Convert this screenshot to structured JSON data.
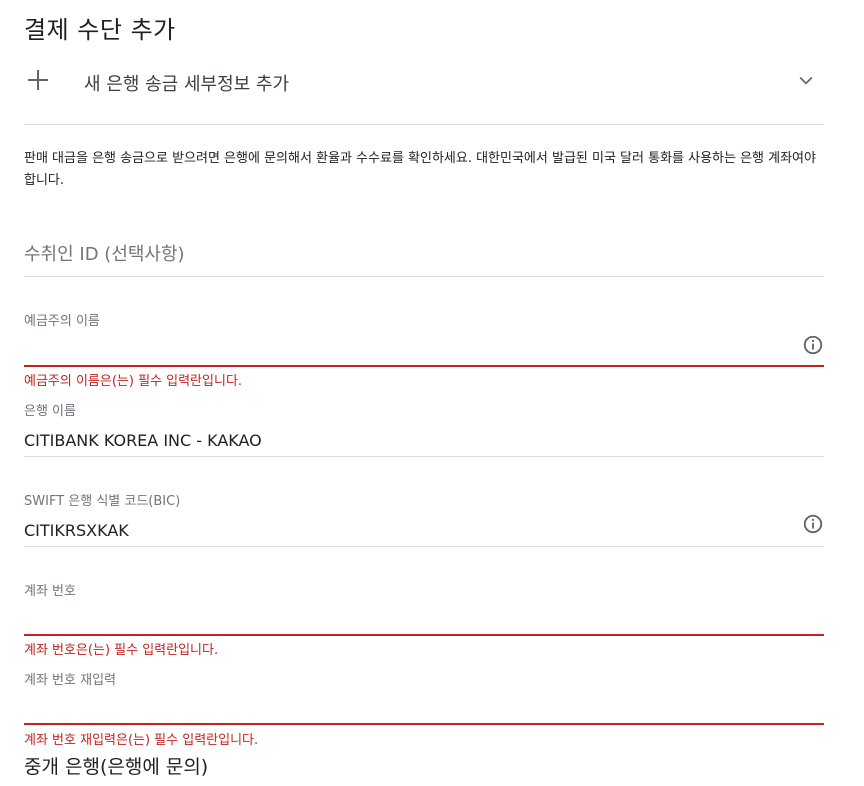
{
  "title": "결제 수단 추가",
  "expander": {
    "label": "새 은행 송금 세부정보 추가"
  },
  "description": "판매 대금을 은행 송금으로 받으려면 은행에 문의해서 환율과 수수료를 확인하세요. 대한민국에서 발급된 미국 달러 통화를 사용하는 은행 계좌여야 합니다.",
  "fields": {
    "payee_id": {
      "placeholder": "수취인 ID (선택사항)"
    },
    "account_holder": {
      "label": "예금주의 이름",
      "value": "",
      "error": "예금주의 이름은(는) 필수 입력란입니다."
    },
    "bank_name": {
      "label": "은행 이름",
      "value": "CITIBANK KOREA INC - KAKAO"
    },
    "swift": {
      "label": "SWIFT 은행 식별 코드(BIC)",
      "value": "CITIKRSXKAK"
    },
    "account_number": {
      "label": "계좌 번호",
      "value": "",
      "error": "계좌 번호은(는) 필수 입력란입니다."
    },
    "account_number_confirm": {
      "label": "계좌 번호 재입력",
      "value": "",
      "error": "계좌 번호 재입력은(는) 필수 입력란입니다."
    }
  },
  "intermediary_bank": {
    "label": "중개 은행(은행에 문의)"
  },
  "colors": {
    "error": "#c5221f",
    "divider": "#dadce0",
    "icon": "#5f6368"
  },
  "icons": [
    "plus-icon",
    "chevron-down-icon",
    "info-icon"
  ]
}
